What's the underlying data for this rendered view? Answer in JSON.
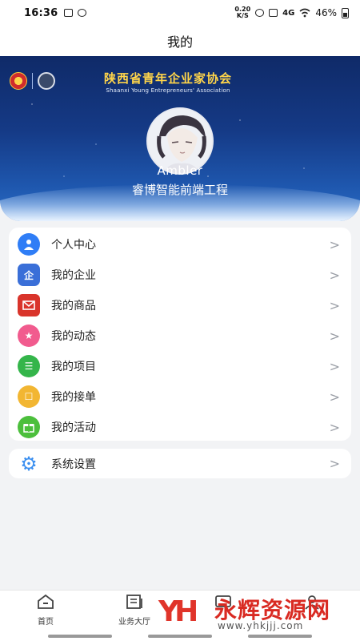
{
  "status_bar": {
    "time": "16:36",
    "net_speed_top": "0.20",
    "net_speed_bottom": "K/S",
    "signal": "4G",
    "battery": "46%"
  },
  "page": {
    "title": "我的"
  },
  "banner": {
    "association_cn": "陕西省青年企业家协会",
    "association_en": "Shaanxi Young Entrepreneurs' Association",
    "username": "Ambler",
    "company": "睿博智能前端工程"
  },
  "menu": {
    "items": [
      {
        "label": "个人中心",
        "icon": "person-icon",
        "color": "#2f7df6",
        "glyph": "●"
      },
      {
        "label": "我的企业",
        "icon": "enterprise-icon",
        "color": "#3a6fd8",
        "glyph": "企"
      },
      {
        "label": "我的商品",
        "icon": "mail-icon",
        "color": "#d9342b",
        "glyph": "✉"
      },
      {
        "label": "我的动态",
        "icon": "star-icon",
        "color": "#f15b8e",
        "glyph": "★"
      },
      {
        "label": "我的项目",
        "icon": "list-icon",
        "color": "#34b54a",
        "glyph": "☰"
      },
      {
        "label": "我的接单",
        "icon": "order-icon",
        "color": "#f2b632",
        "glyph": "☐"
      },
      {
        "label": "我的活动",
        "icon": "gift-icon",
        "color": "#4cbf3c",
        "glyph": "❒"
      }
    ],
    "chevron": ">"
  },
  "settings": {
    "label": "系统设置",
    "icon": "gear-icon",
    "color": "#3b8ff0",
    "glyph": "⚙"
  },
  "bottom_nav": {
    "tabs": [
      {
        "label": "首页",
        "icon": "home-icon"
      },
      {
        "label": "业务大厅",
        "icon": "hall-icon"
      },
      {
        "label": "",
        "icon": "message-icon"
      },
      {
        "label": "",
        "icon": "profile-icon"
      }
    ]
  },
  "watermark": {
    "text": "永辉资源网",
    "url": "www.yhkjjj.com",
    "logo": "YH"
  }
}
